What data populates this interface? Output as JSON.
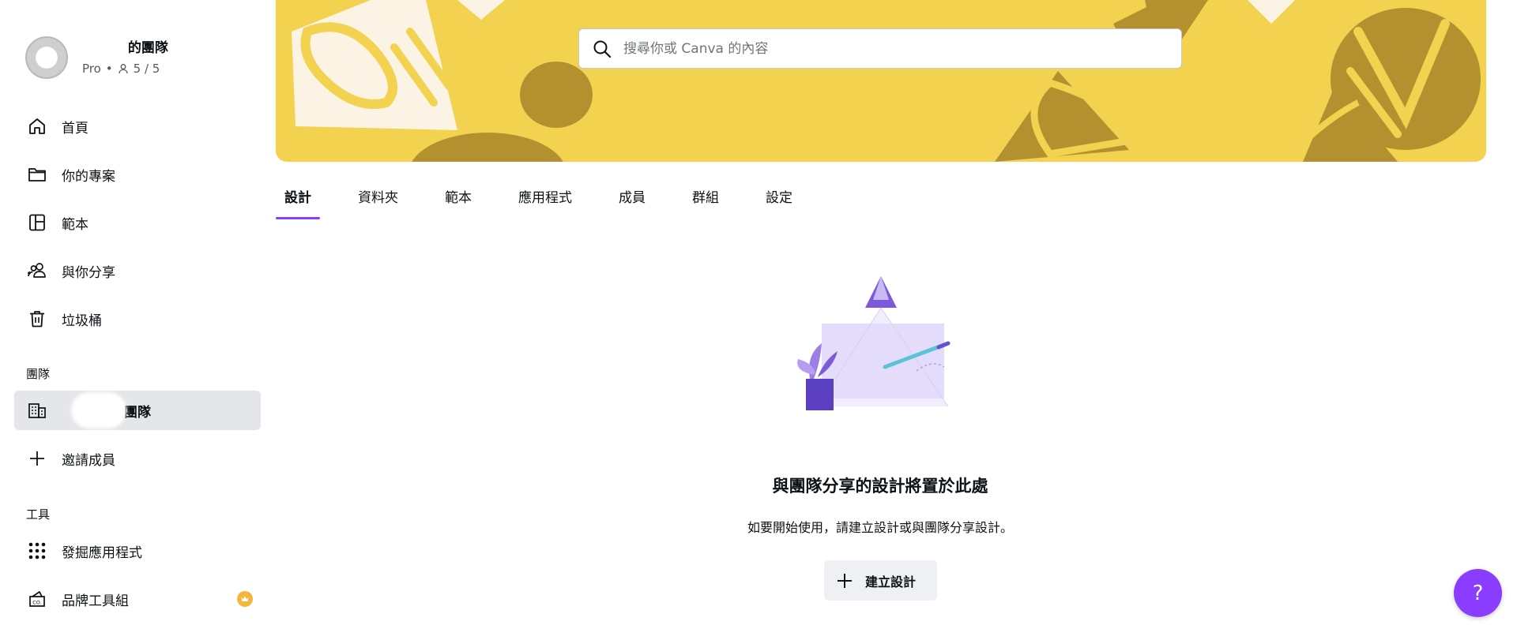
{
  "team": {
    "name": "的團隊",
    "plan": "Pro",
    "separator": "•",
    "members": "5 / 5"
  },
  "sidebar": {
    "items": [
      {
        "label": "首頁",
        "icon": "home-icon"
      },
      {
        "label": "你的專案",
        "icon": "folder-icon"
      },
      {
        "label": "範本",
        "icon": "template-icon"
      },
      {
        "label": "與你分享",
        "icon": "shared-users-icon"
      },
      {
        "label": "垃圾桶",
        "icon": "trash-icon"
      }
    ],
    "team_section": "團隊",
    "team_item": "的團隊",
    "invite_label": "邀請成員",
    "tools_section": "工具",
    "tools": [
      {
        "label": "發掘應用程式",
        "icon": "apps-grid-icon"
      },
      {
        "label": "品牌工具組",
        "icon": "brand-kit-icon",
        "badge": "crown-icon"
      }
    ]
  },
  "search": {
    "placeholder": "搜尋你或 Canva 的內容"
  },
  "tabs": [
    "設計",
    "資料夾",
    "範本",
    "應用程式",
    "成員",
    "群組",
    "設定"
  ],
  "active_tab": "設計",
  "empty_state": {
    "title": "與團隊分享的設計將置於此處",
    "subtitle": "如要開始使用，請建立設計或與團隊分享設計。",
    "button_label": "建立設計"
  },
  "help_label": "?",
  "colors": {
    "accent": "#8b3dff",
    "banner": "#f2d24e",
    "banner_dark": "#b5902f",
    "active_bg": "#e5e6e9"
  }
}
